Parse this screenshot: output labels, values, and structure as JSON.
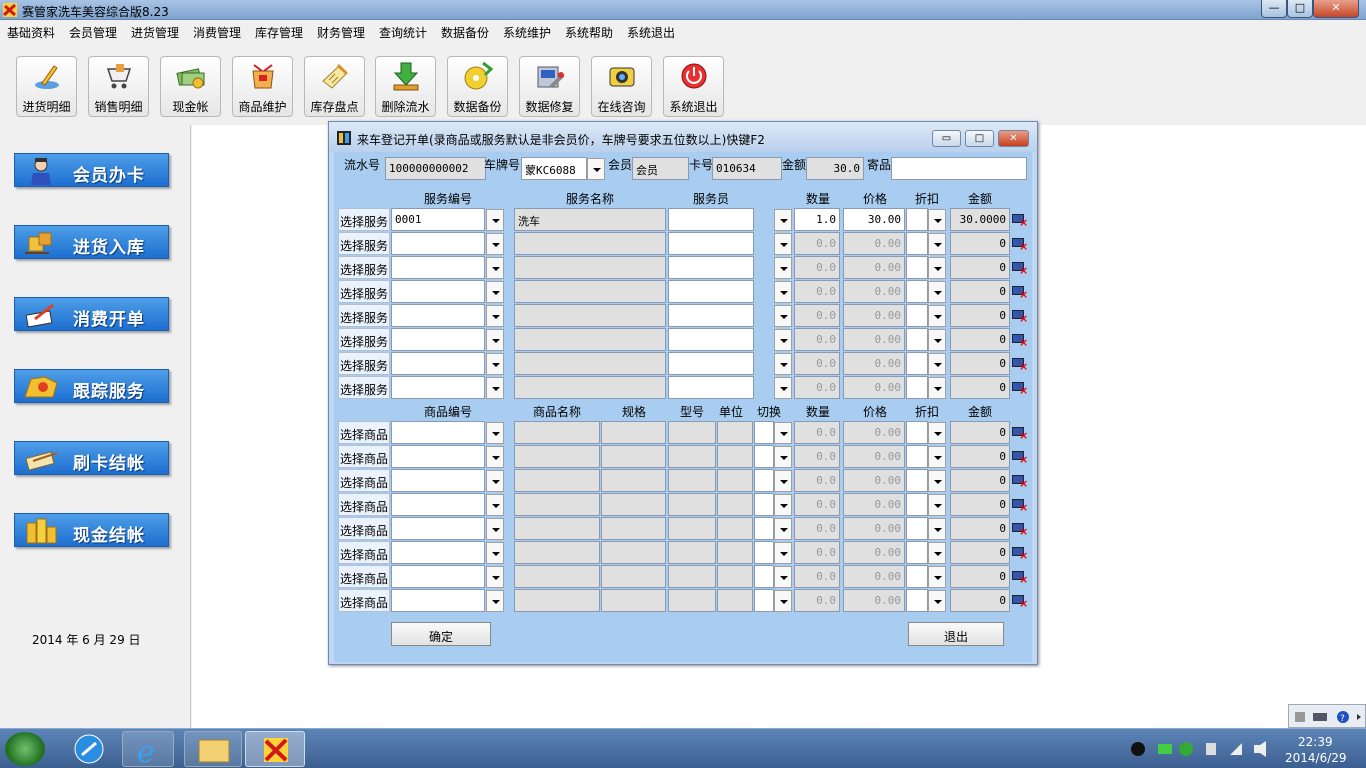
{
  "window": {
    "title": "赛管家洗车美容综合版8.23",
    "min": "—",
    "max": "□",
    "close": "✕"
  },
  "menu": [
    "基础资料",
    "会员管理",
    "进货管理",
    "消费管理",
    "库存管理",
    "财务管理",
    "查询统计",
    "数据备份",
    "系统维护",
    "系统帮助",
    "系统退出"
  ],
  "toolbar": [
    {
      "label": "进货明细",
      "icon": "pen-icon"
    },
    {
      "label": "销售明细",
      "icon": "cart-icon"
    },
    {
      "label": "现金帐",
      "icon": "money-icon"
    },
    {
      "label": "商品维护",
      "icon": "box-icon"
    },
    {
      "label": "库存盘点",
      "icon": "checklist-icon"
    },
    {
      "label": "删除流水",
      "icon": "download-arrow-icon"
    },
    {
      "label": "数据备份",
      "icon": "disk-backup-icon"
    },
    {
      "label": "数据修复",
      "icon": "repair-icon"
    },
    {
      "label": "在线咨询",
      "icon": "camera-icon"
    },
    {
      "label": "系统退出",
      "icon": "power-icon"
    }
  ],
  "sidebar": [
    {
      "label": "会员办卡",
      "icon": "person-icon"
    },
    {
      "label": "进货入库",
      "icon": "stock-in-icon"
    },
    {
      "label": "消费开单",
      "icon": "write-icon"
    },
    {
      "label": "跟踪服务",
      "icon": "track-icon"
    },
    {
      "label": "刷卡结帐",
      "icon": "card-icon"
    },
    {
      "label": "现金结帐",
      "icon": "coins-icon"
    }
  ],
  "date": "2014 年   6 月 29 日",
  "dialog": {
    "title": "来车登记开单(录商品或服务默认是非会员价，车牌号要求五位数以上)快键F2",
    "min": "▭",
    "max": "□",
    "close": "✕",
    "fields": {
      "serial_label": "流水号",
      "serial": "100000000002",
      "plate_label": "车牌号",
      "plate": "蒙KC6088",
      "member_label": "会员",
      "member": "会员",
      "card_label": "卡号",
      "card": "010634",
      "amount_label": "金额",
      "amount": "30.0",
      "deposit_label": "寄品",
      "deposit": ""
    },
    "service_headers": [
      "服务编号",
      "服务名称",
      "服务员",
      "数量",
      "价格",
      "折扣",
      "金额"
    ],
    "service_select_label": "选择服务",
    "service_rows": [
      {
        "code": "0001",
        "name": "洗车",
        "staff": "",
        "qty": "1.0",
        "price": "30.00",
        "disc": "",
        "amt": "30.0000"
      },
      {
        "code": "",
        "name": "",
        "staff": "",
        "qty": "0.0",
        "price": "0.00",
        "disc": "",
        "amt": "0"
      },
      {
        "code": "",
        "name": "",
        "staff": "",
        "qty": "0.0",
        "price": "0.00",
        "disc": "",
        "amt": "0"
      },
      {
        "code": "",
        "name": "",
        "staff": "",
        "qty": "0.0",
        "price": "0.00",
        "disc": "",
        "amt": "0"
      },
      {
        "code": "",
        "name": "",
        "staff": "",
        "qty": "0.0",
        "price": "0.00",
        "disc": "",
        "amt": "0"
      },
      {
        "code": "",
        "name": "",
        "staff": "",
        "qty": "0.0",
        "price": "0.00",
        "disc": "",
        "amt": "0"
      },
      {
        "code": "",
        "name": "",
        "staff": "",
        "qty": "0.0",
        "price": "0.00",
        "disc": "",
        "amt": "0"
      },
      {
        "code": "",
        "name": "",
        "staff": "",
        "qty": "0.0",
        "price": "0.00",
        "disc": "",
        "amt": "0"
      }
    ],
    "goods_headers": [
      "商品编号",
      "商品名称",
      "规格",
      "型号",
      "单位",
      "切换",
      "数量",
      "价格",
      "折扣",
      "金额"
    ],
    "goods_select_label": "选择商品",
    "goods_rows": [
      {
        "qty": "0.0",
        "price": "0.00",
        "amt": "0"
      },
      {
        "qty": "0.0",
        "price": "0.00",
        "amt": "0"
      },
      {
        "qty": "0.0",
        "price": "0.00",
        "amt": "0"
      },
      {
        "qty": "0.0",
        "price": "0.00",
        "amt": "0"
      },
      {
        "qty": "0.0",
        "price": "0.00",
        "amt": "0"
      },
      {
        "qty": "0.0",
        "price": "0.00",
        "amt": "0"
      },
      {
        "qty": "0.0",
        "price": "0.00",
        "amt": "0"
      },
      {
        "qty": "0.0",
        "price": "0.00",
        "amt": "0"
      }
    ],
    "ok_label": "确定",
    "exit_label": "退出"
  },
  "taskbar": {
    "time": "22:39",
    "date": "2014/6/29"
  }
}
